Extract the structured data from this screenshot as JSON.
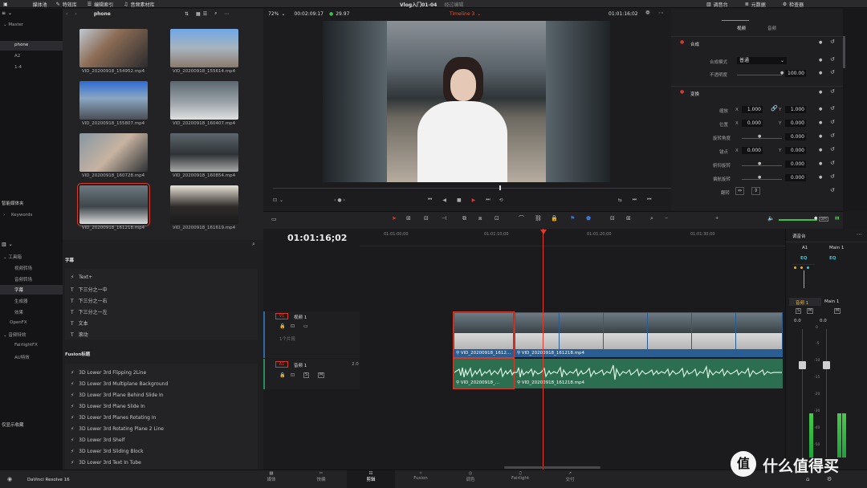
{
  "topbar": {
    "media_pool": "媒体池",
    "effects_library": "特效库",
    "edit_index": "编辑索引",
    "sound_library": "音频素材库",
    "project_title": "Vlog入门01-04",
    "edited": "经过编辑",
    "mixer": "调音台",
    "metadata": "元数据",
    "inspector": "检查器"
  },
  "media": {
    "bin_label": "phone",
    "bins": [
      "Master",
      "phone",
      "A2",
      "1-4"
    ],
    "smart_bins": "智能媒体夹",
    "keywords": "Keywords",
    "clips": [
      "VID_20200918_154952.mp4",
      "VID_20200918_155614.mp4",
      "VID_20200918_155807.mp4",
      "VID_20200918_160407.mp4",
      "VID_20200918_160728.mp4",
      "VID_20200918_160854.mp4",
      "VID_20200918_161218.mp4",
      "VID_20200918_161619.mp4"
    ]
  },
  "viewer": {
    "zoom": "72%",
    "duration": "00:02:09:17",
    "fps": "29.97",
    "timeline_name": "Timeline 3",
    "timecode": "01:01:16;02"
  },
  "inspector": {
    "tabs": [
      "视频",
      "音频"
    ],
    "composite": {
      "title": "合成",
      "mode_label": "合成模式",
      "mode_value": "普通",
      "opacity_label": "不透明度",
      "opacity_value": "100.00"
    },
    "transform": {
      "title": "变换",
      "zoom_label": "缩放",
      "zoom_x": "1.000",
      "zoom_y": "1.000",
      "position_label": "位置",
      "position_x": "0.000",
      "position_y": "0.000",
      "rotation_label": "旋转角度",
      "rotation_value": "0.000",
      "anchor_label": "锚点",
      "anchor_x": "0.000",
      "anchor_y": "0.000",
      "pitch_label": "俯仰旋转",
      "pitch_value": "0.000",
      "yaw_label": "偏航旋转",
      "yaw_value": "0.000",
      "flip_label": "翻转",
      "x": "X",
      "y": "Y"
    }
  },
  "effects": {
    "tree": [
      "工具箱",
      "视频转场",
      "音频转场",
      "字幕",
      "生成器",
      "效果",
      "OpenFX",
      "音频特效",
      "FairlightFX",
      "AU特效"
    ],
    "favorites": "仅显示收藏",
    "titles_header": "字幕",
    "titles": [
      "Text+",
      "下三分之一中",
      "下三分之一右",
      "下三分之一左",
      "文本",
      "滚动"
    ],
    "fusion_header": "Fusion标题",
    "fusion_titles": [
      "3D Lower 3rd Flipping 2Line",
      "3D Lower 3rd Multiplane Background",
      "3D Lower 3rd Plane Behind Slide In",
      "3D Lower 3rd Plane Slide In",
      "3D Lower 3rd Planes Rotating In",
      "3D Lower 3rd Rotating Plane 2 Line",
      "3D Lower 3rd Shelf",
      "3D Lower 3rd Sliding Block",
      "3D Lower 3rd Text In Tube"
    ]
  },
  "timeline": {
    "timecode": "01:01:16;02",
    "ruler": [
      "01:01:00;00",
      "01:01:10;00",
      "01:01:20;00",
      "01:01:30;00"
    ],
    "video_track": {
      "id": "V1",
      "name": "视频 1",
      "sub": "1个片段"
    },
    "audio_track": {
      "id": "A1",
      "name": "音频 1",
      "level": "2.0"
    },
    "clip_short": "VID_20200918_1612...",
    "clip_full": "VID_20200918_161218.mp4",
    "aclip_short": "VID_20200918_...",
    "aclip_full": "VID_20200918_161218.mp4"
  },
  "mixer": {
    "title": "调音台",
    "ch1": "A1",
    "ch2": "Main 1",
    "eq": "EQ",
    "track_name": "音频 1",
    "main_name": "Main 1",
    "s": "S",
    "m": "M",
    "db1": "0.0",
    "db2": "0.0",
    "scale": [
      "0",
      "-5",
      "-10",
      "-15",
      "-20",
      "-30",
      "-40",
      "-50"
    ]
  },
  "pages": [
    "媒体",
    "快编",
    "剪辑",
    "Fusion",
    "调色",
    "Fairlight",
    "交付"
  ],
  "app": "DaVinci Resolve 16",
  "watermark": "值 什么值得买"
}
